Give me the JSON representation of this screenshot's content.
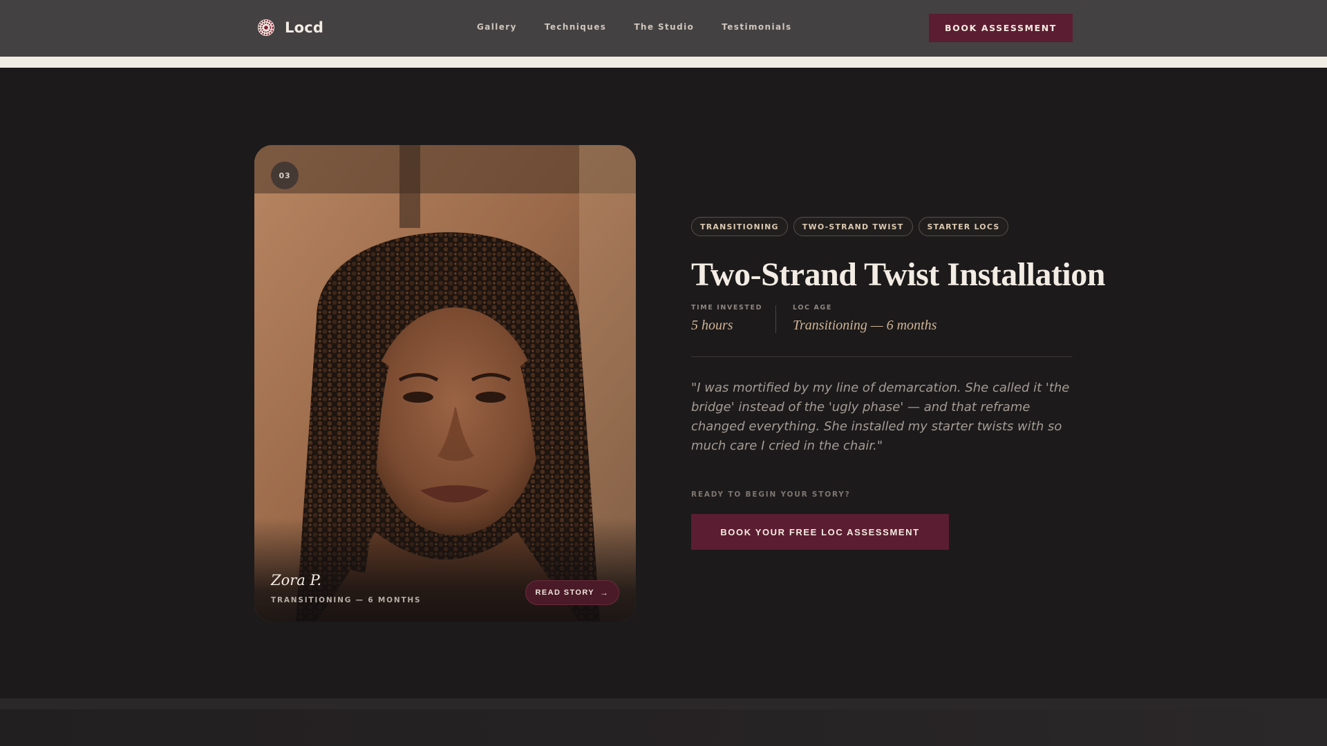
{
  "header": {
    "brand": "Locd",
    "nav": [
      "Gallery",
      "Techniques",
      "The Studio",
      "Testimonials"
    ],
    "cta": "BOOK ASSESSMENT"
  },
  "card": {
    "number": "03",
    "client_name": "Zora P.",
    "client_sub": "TRANSITIONING — 6 MONTHS",
    "read_label": "READ STORY",
    "read_icon": "arrow-right-icon"
  },
  "story": {
    "tags": [
      "TRANSITIONING",
      "TWO-STRAND TWIST",
      "STARTER LOCS"
    ],
    "title": "Two-Strand Twist Installation",
    "stats": [
      {
        "label": "TIME INVESTED",
        "value": "5 hours"
      },
      {
        "label": "LOC AGE",
        "value": "Transitioning — 6 months"
      }
    ],
    "quote": "\"I was mortified by my line of demarcation. She called it 'the bridge' instead of the 'ugly phase' — and that reframe changed everything. She installed my starter twists with so much care I cried in the chair.\"",
    "cta_label": "READY TO BEGIN YOUR STORY?",
    "cta_button": "BOOK YOUR FREE LOC ASSESSMENT"
  },
  "colors": {
    "header_bg": "#444142",
    "page_bg": "#1c1a1b",
    "accent_burgundy": "#5b1d31",
    "gold_text": "#d1b596",
    "cream_strip": "#f2ede4"
  }
}
